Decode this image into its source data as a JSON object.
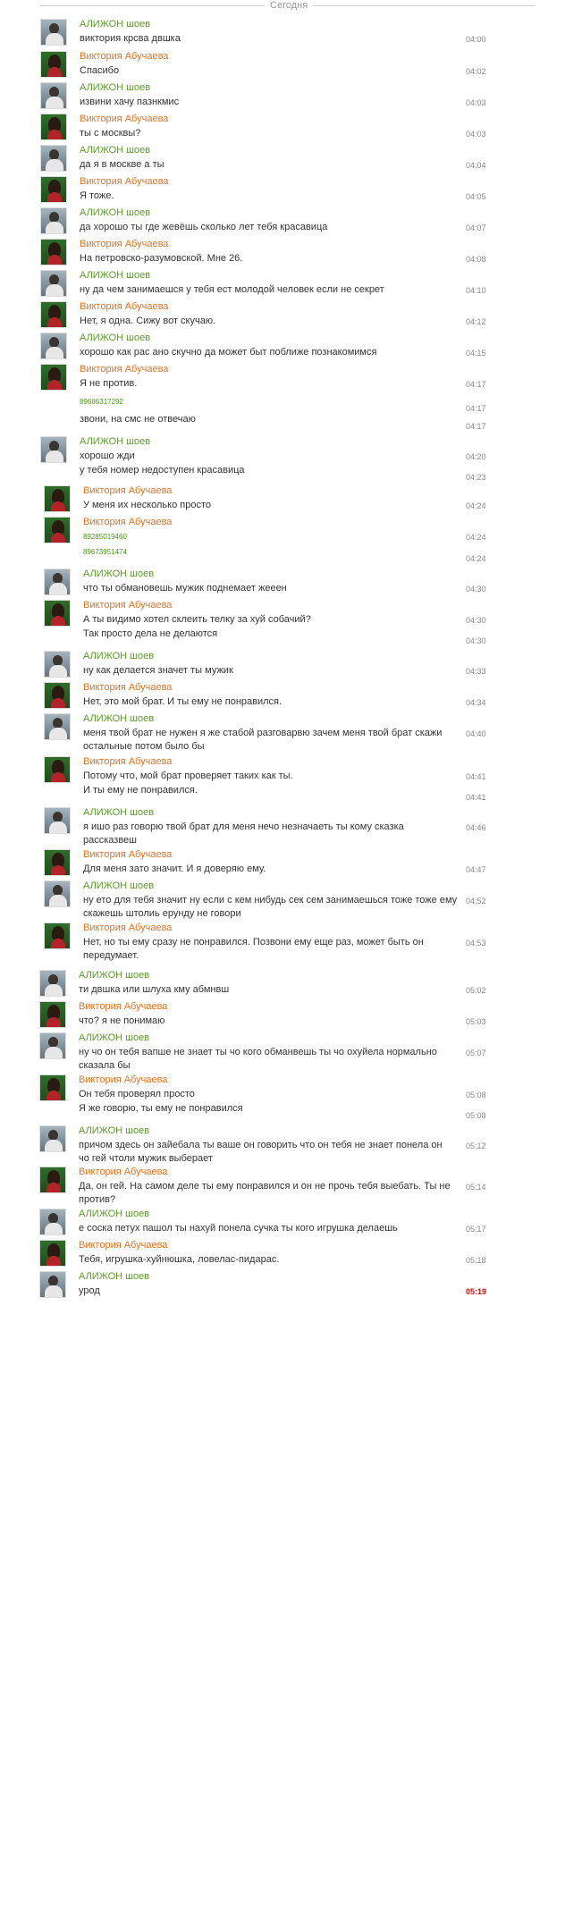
{
  "header": {
    "day_label": "Сегодня"
  },
  "participants": {
    "m": {
      "name": "АЛИЖОН шоев"
    },
    "f": {
      "name": "Виктория Абучаева"
    }
  },
  "messages": [
    {
      "who": "m",
      "avatar": true,
      "text": "виктория крсва двшка",
      "time": "04:00"
    },
    {
      "who": "f",
      "avatar": true,
      "text": "Спасибо",
      "time": "04:02"
    },
    {
      "who": "m",
      "avatar": true,
      "text": "извини хачу пазнкмис",
      "time": "04:03"
    },
    {
      "who": "f",
      "avatar": true,
      "text": "ты с москвы?",
      "time": "04:03"
    },
    {
      "who": "m",
      "avatar": true,
      "text": "да я в москве а ты",
      "time": "04:04"
    },
    {
      "who": "f",
      "avatar": true,
      "text": "Я тоже.",
      "time": "04:05"
    },
    {
      "who": "m",
      "avatar": true,
      "text": "да хорошо ты где жевёшь сколько лет тебя красавица",
      "time": "04:07"
    },
    {
      "who": "f",
      "avatar": true,
      "text": "На петровско-разумовской. Мне 26.",
      "time": "04:08"
    },
    {
      "who": "m",
      "avatar": true,
      "text": "ну да чем занимаешся у тебя ест молодой человек если не секрет",
      "time": "04:10"
    },
    {
      "who": "f",
      "avatar": true,
      "text": "Нет, я одна. Сижу вот скучаю.",
      "time": "04:12"
    },
    {
      "who": "m",
      "avatar": true,
      "text": "хорошо как рас ано скучно да может быт поближе познакомимся",
      "time": "04:15"
    },
    {
      "who": "f",
      "avatar": true,
      "text": "Я не против.",
      "time": "04:17"
    },
    {
      "who": "f",
      "avatar": false,
      "phone": true,
      "text": "89686317292",
      "time": "04:17"
    },
    {
      "who": "f",
      "avatar": false,
      "text": "звони, на смс не отвечаю",
      "time": "04:17"
    },
    {
      "who": "m",
      "avatar": true,
      "text": "хорошо жди",
      "time": "04:20"
    },
    {
      "who": "m",
      "avatar": false,
      "text": "у тебя номер недоступен красавица",
      "time": "04:23"
    },
    {
      "who": "f",
      "avatar": true,
      "text": "У меня их несколько просто",
      "time": "04:24"
    },
    {
      "who": "f",
      "avatar": true,
      "phone": true,
      "text": "89285019460",
      "time": "04:24"
    },
    {
      "who": "f",
      "avatar": false,
      "phone": true,
      "text": "89673951474",
      "time": "04:24"
    },
    {
      "who": "m",
      "avatar": true,
      "text": "что ты обмановешь мужик поднемает жееен",
      "time": "04:30"
    },
    {
      "who": "f",
      "avatar": true,
      "text": "А ты видимо хотел  склеить телку за хуй собачий?",
      "time": "04:30"
    },
    {
      "who": "f",
      "avatar": false,
      "text": "Так просто дела не делаются",
      "time": "04:30"
    },
    {
      "who": "m",
      "avatar": true,
      "text": "ну как делается значет ты мужик",
      "time": "04:33"
    },
    {
      "who": "f",
      "avatar": true,
      "text": "Нет, это мой брат. И ты ему не понравился.",
      "time": "04:34"
    },
    {
      "who": "m",
      "avatar": true,
      "text": "меня твой брат не нужен я же стабой разговарвю зачем меня твой брат скажи остальные потом было бы",
      "time": "04:40"
    },
    {
      "who": "f",
      "avatar": true,
      "text": "Потому что, мой брат проверяет таких как ты.",
      "time": "04:41"
    },
    {
      "who": "f",
      "avatar": false,
      "text": "И ты ему не понравился.",
      "time": "04:41"
    },
    {
      "who": "m",
      "avatar": true,
      "text": "я ишо раз говорю твой брат для меня нечо незначаеть ты кому сказка рассказвеш",
      "time": "04:46"
    },
    {
      "who": "f",
      "avatar": true,
      "text": "Для меня зато значит. И я доверяю ему.",
      "time": "04:47"
    },
    {
      "who": "m",
      "avatar": true,
      "text": "ну ето для тебя значит ну если с кем нибудь сек сем занимаешься тоже тоже ему скажешь штолиь ерунду не говори",
      "time": "04:52"
    },
    {
      "who": "f",
      "avatar": true,
      "text": "Нет, но ты ему сразу не понравился. Позвони ему еще раз, может быть он передумает.",
      "time": "04:53"
    },
    {
      "who": "m",
      "avatar": true,
      "text": "ти двшка или шлуха кму абмнвш",
      "time": "05:02"
    },
    {
      "who": "f",
      "avatar": true,
      "text": "что? я не понимаю",
      "time": "05:03"
    },
    {
      "who": "m",
      "avatar": true,
      "text": "ну чо он тебя вапше не знает ты чо кого  обманвешь ты чо охуйела нормально сказала бы",
      "time": "05:07"
    },
    {
      "who": "f",
      "avatar": true,
      "text": "Он тебя проверял просто",
      "time": "05:08"
    },
    {
      "who": "f",
      "avatar": false,
      "text": "Я же говорю, ты ему не понравился",
      "time": "05:08"
    },
    {
      "who": "m",
      "avatar": true,
      "text": "причом здесь он зайебала ты ваше он говорить что он тебя не знает понела он чо гей чтоли мужик выберает",
      "time": "05:12"
    },
    {
      "who": "f",
      "avatar": true,
      "text": "Да, он гей. На самом деле ты ему понравился и он не прочь тебя выебать. Ты не против?",
      "time": "05:14"
    },
    {
      "who": "m",
      "avatar": true,
      "text": "е соска петух пашол ты нахуй понела сучка ты кого игрушка делаешь",
      "time": "05:17"
    },
    {
      "who": "f",
      "avatar": true,
      "text": "Тебя, игрушка-хуйнюшка, ловелас-пидарас.",
      "time": "05:18"
    },
    {
      "who": "m",
      "avatar": true,
      "text": "урод",
      "time": "05:19",
      "highlight": true
    }
  ]
}
